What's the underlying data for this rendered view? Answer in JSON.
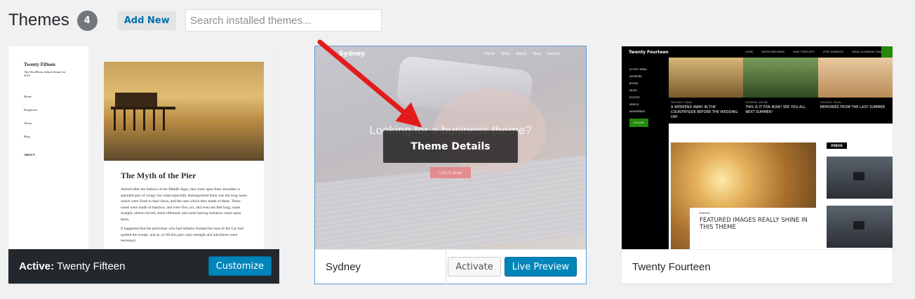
{
  "header": {
    "title": "Themes",
    "count": "4",
    "add_new": "Add New",
    "search_placeholder": "Search installed themes..."
  },
  "themes": [
    {
      "label_prefix": "Active:",
      "name": "Twenty Fifteen",
      "action": "Customize",
      "preview": {
        "site_title": "Twenty Fifteen",
        "tagline": "The WordPress default theme for 2015.",
        "menu": [
          "Home",
          "Dropdown",
          "About",
          "Blog"
        ],
        "about_heading": "ABOUT",
        "post_title": "The Myth of the Pier",
        "post_excerpt": "Attired after the fashion of the Middle Ages, they bore upon their shoulders a splendid pair of wings; but what especially distinguished them was the long noses which were fixed to their faces, and the uses which they made of them. These noses were made of bamboo, and were five, six, and even ten feet long, some straight, others curved, some ribboned, and some having imitation warts upon them.",
        "post_excerpt_2": "It happened that the performer who had hitherto formed the base of the Car had quitted the troupe, and as, to fill this part, only strength and adroitness were necessary."
      }
    },
    {
      "name": "Sydney",
      "overlay": "Theme Details",
      "actions": [
        "Activate",
        "Live Preview"
      ],
      "preview": {
        "logo": "Sydney",
        "nav": [
          "Home",
          "Work",
          "About",
          "Blog",
          "Contact"
        ],
        "headline": "Looking for a business theme?",
        "button": "CLICK TO BEGIN"
      }
    },
    {
      "name": "Twenty Fourteen",
      "preview": {
        "logo": "Twenty Fourteen",
        "menu": [
          "HOME",
          "DROPDOWN MENU",
          "PAGE TEMPLATES",
          "HTML ELEMENTS",
          "IMAGE ALIGNMENT AND STYLES"
        ],
        "sidebar": [
          "IS POST MENU",
          "ARTWORK",
          "BOOKS",
          "MUSIC",
          "PHOTOS",
          "VIDEOS",
          "WORDPRESS"
        ],
        "follow": "FOLLOW",
        "featured": [
          {
            "cat": "FEATURED, TRAVEL",
            "title": "A WEEKEND AWAY IN THE COUNTRYSIDE BEFORE THE WEDDING DAY"
          },
          {
            "cat": "FEATURED, NATURE",
            "title": "THIS IS IT FOR NOW! SEE YOU ALL NEXT SUMMER!"
          },
          {
            "cat": "FEATURED, TRAVEL",
            "title": "MEMORIES FROM THE LAST SUMMER"
          }
        ],
        "post_cat": "PHOTOS",
        "post_title": "FEATURED IMAGES REALLY SHINE IN THIS THEME",
        "videos": "VIDEOS"
      }
    }
  ]
}
